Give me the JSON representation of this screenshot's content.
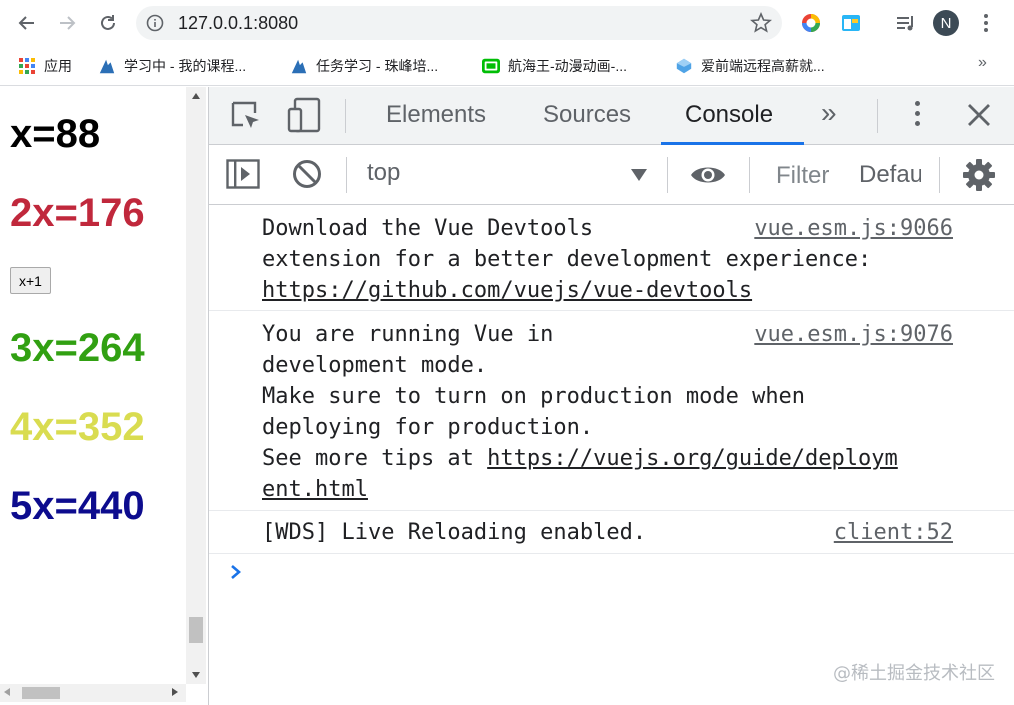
{
  "browser": {
    "url": "127.0.0.1:8080",
    "avatar_letter": "N"
  },
  "bookmarks": [
    {
      "label": "应用"
    },
    {
      "label": "学习中 - 我的课程..."
    },
    {
      "label": "任务学习 - 珠峰培..."
    },
    {
      "label": "航海王-动漫动画-..."
    },
    {
      "label": "爱前端远程高薪就..."
    }
  ],
  "bookmarks_more": "»",
  "page": {
    "equations": [
      {
        "text": "x=88",
        "color": "#000000"
      },
      {
        "text": "2x=176",
        "color": "#c0283c"
      },
      {
        "text": "3x=264",
        "color": "#31a012"
      },
      {
        "text": "4x=352",
        "color": "#d9dc50"
      },
      {
        "text": "5x=440",
        "color": "#0d0c8e"
      }
    ],
    "button_label": "x+1"
  },
  "devtools": {
    "tabs": [
      "Elements",
      "Sources",
      "Console"
    ],
    "active_tab": "Console",
    "more_tabs": "»",
    "context": "top",
    "filter_placeholder": "Filter",
    "levels": "Default levels",
    "accent": "#1a73e8",
    "messages": [
      {
        "lines": [
          "Download the Vue Devtools",
          "extension for a better development experience:"
        ],
        "link": "https://github.com/vuejs/vue-devtools",
        "source": "vue.esm.js:9066"
      },
      {
        "lines": [
          "You are running Vue in",
          "development mode.",
          "Make sure to turn on production mode when",
          "deploying for production.",
          "See more tips at "
        ],
        "link_a": "https://vuejs.org/guide/deploym",
        "link_b": "ent.html",
        "source": "vue.esm.js:9076"
      },
      {
        "lines": [
          "[WDS] Live Reloading enabled."
        ],
        "source": "client:52"
      }
    ],
    "prompt_symbol": "›"
  },
  "watermark": "@稀土掘金技术社区"
}
